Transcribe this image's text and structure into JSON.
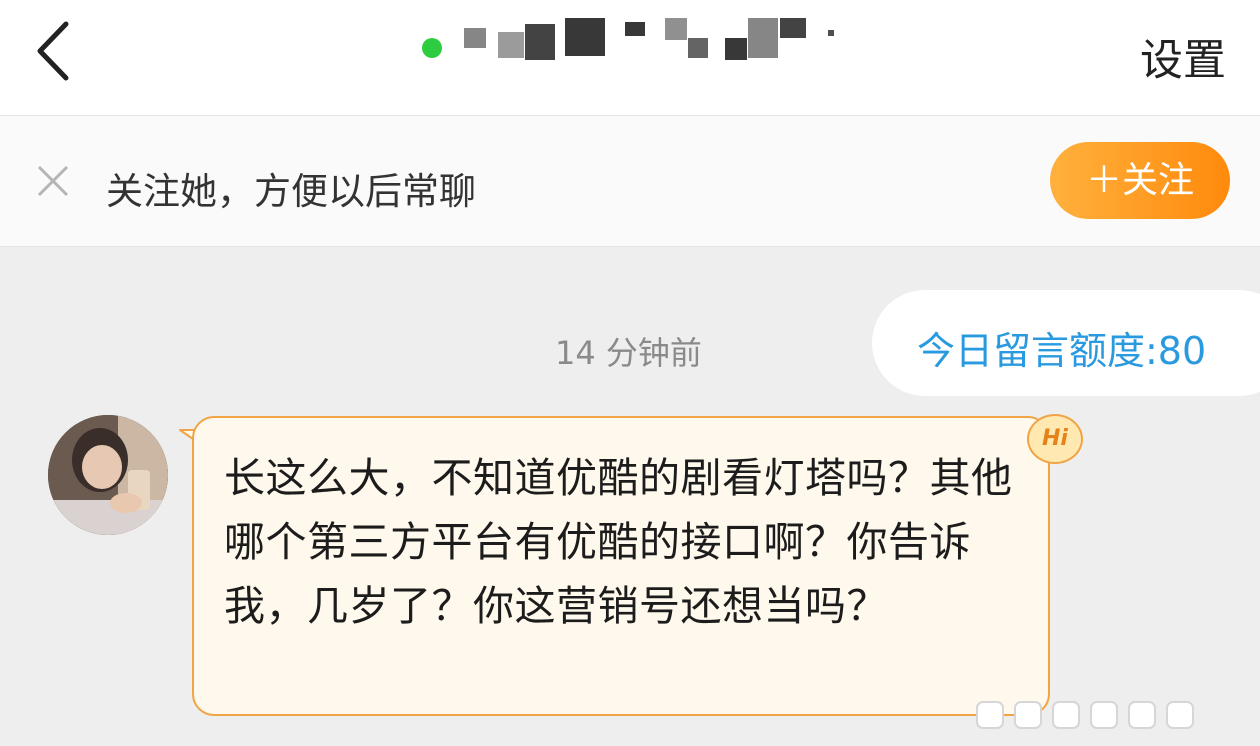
{
  "header": {
    "back_icon": "chevron-left-icon",
    "online_color": "#2ecc40",
    "settings_label": "设置"
  },
  "follow_bar": {
    "close_icon": "close-icon",
    "tip": "关注她，方便以后常聊",
    "follow_button": "＋关注",
    "accent": "#ff9a1f"
  },
  "chat": {
    "quota": "今日留言额度:80",
    "quota_color": "#2a9ae0",
    "timestamp": "14 分钟前",
    "message": {
      "badge": "Hi",
      "text": "长这么大，不知道优酷的剧看灯塔吗？其他哪个第三方平台有优酷的接口啊？你告诉我，几岁了？你这营销号还想当吗？",
      "bubble_border": "#f0a446"
    }
  }
}
